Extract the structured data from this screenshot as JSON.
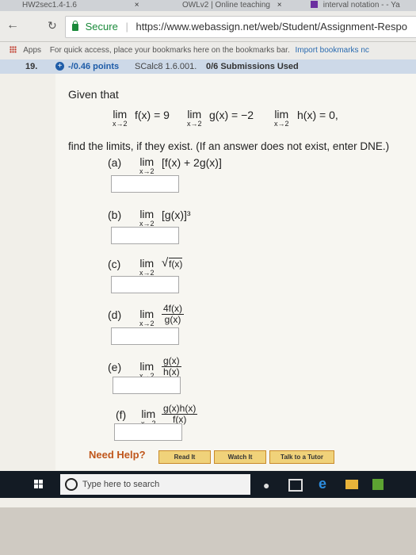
{
  "browser": {
    "tabs": [
      {
        "label": "HW2sec1.4-1.6",
        "close": "×"
      },
      {
        "label": "OWLv2 | Online teaching",
        "close": "×"
      },
      {
        "label": "interval notation - - Ya"
      }
    ],
    "secure_label": "Secure",
    "url": "https://www.webassign.net/web/Student/Assignment-Respo",
    "bookmarks": {
      "apps_label": "Apps",
      "message": "For quick access, place your bookmarks here on the bookmarks bar.",
      "import_link": "Import bookmarks nc"
    }
  },
  "question": {
    "number": "19.",
    "points": "-/0.46 points",
    "source": "SCalc8 1.6.001.",
    "submissions": "0/6 Submissions Used"
  },
  "problem": {
    "given_label": "Given that",
    "lim_word": "lim",
    "approach": "x→2",
    "givens": [
      "f(x) = 9",
      "g(x) = −2",
      "h(x) = 0,"
    ],
    "instruction": "find the limits, if they exist. (If an answer does not exist, enter DNE.)",
    "parts": [
      {
        "label": "(a)",
        "expr": "[f(x) + 2g(x)]"
      },
      {
        "label": "(b)",
        "expr": "[g(x)]³"
      },
      {
        "label": "(c)",
        "expr": "f(x)"
      },
      {
        "label": "(d)",
        "num": "4f(x)",
        "den": "g(x)"
      },
      {
        "label": "(e)",
        "num": "g(x)",
        "den": "h(x)"
      },
      {
        "label": "(f)",
        "num": "g(x)h(x)",
        "den": "f(x)"
      }
    ]
  },
  "help": {
    "label": "Need Help?",
    "buttons": [
      "Read It",
      "Watch It",
      "Talk to a Tutor"
    ]
  },
  "taskbar": {
    "search_placeholder": "Type here to search"
  }
}
